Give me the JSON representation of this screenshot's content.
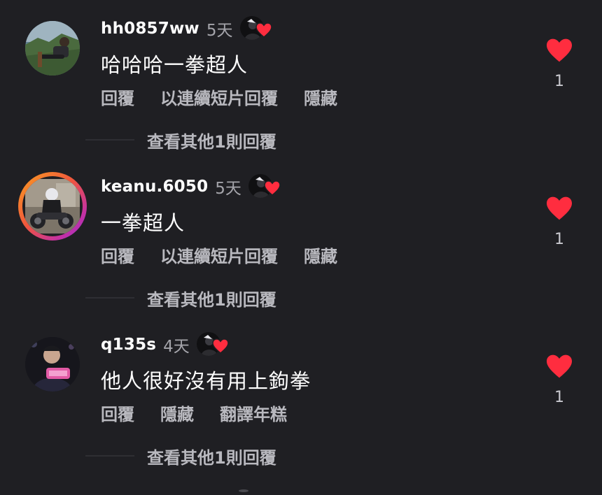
{
  "comments": [
    {
      "username": "hh0857ww",
      "time": "5天",
      "text": "哈哈哈一拳超人",
      "actions": [
        "回覆",
        "以連續短片回覆",
        "隱藏"
      ],
      "more_replies": "查看其他1則回覆",
      "likes": "1",
      "avatar_ring": false
    },
    {
      "username": "keanu.6050",
      "time": "5天",
      "text": "一拳超人",
      "actions": [
        "回覆",
        "以連續短片回覆",
        "隱藏"
      ],
      "more_replies": "查看其他1則回覆",
      "likes": "1",
      "avatar_ring": true
    },
    {
      "username": "q135s",
      "time": "4天",
      "text": "他人很好沒有用上鉤拳",
      "actions": [
        "回覆",
        "隱藏",
        "翻譯年糕"
      ],
      "more_replies": "查看其他1則回覆",
      "likes": "1",
      "avatar_ring": false
    }
  ],
  "colors": {
    "background": "#1f1f23",
    "heart": "#ff2d3f",
    "secondary_text": "#b9b9bf",
    "story_ring": [
      "#f9a020",
      "#f0563d",
      "#c22fa8",
      "#8e3ad6"
    ]
  },
  "icons": {
    "like": "heart-icon",
    "creator_liked": "creator-liked-heart-icon"
  }
}
